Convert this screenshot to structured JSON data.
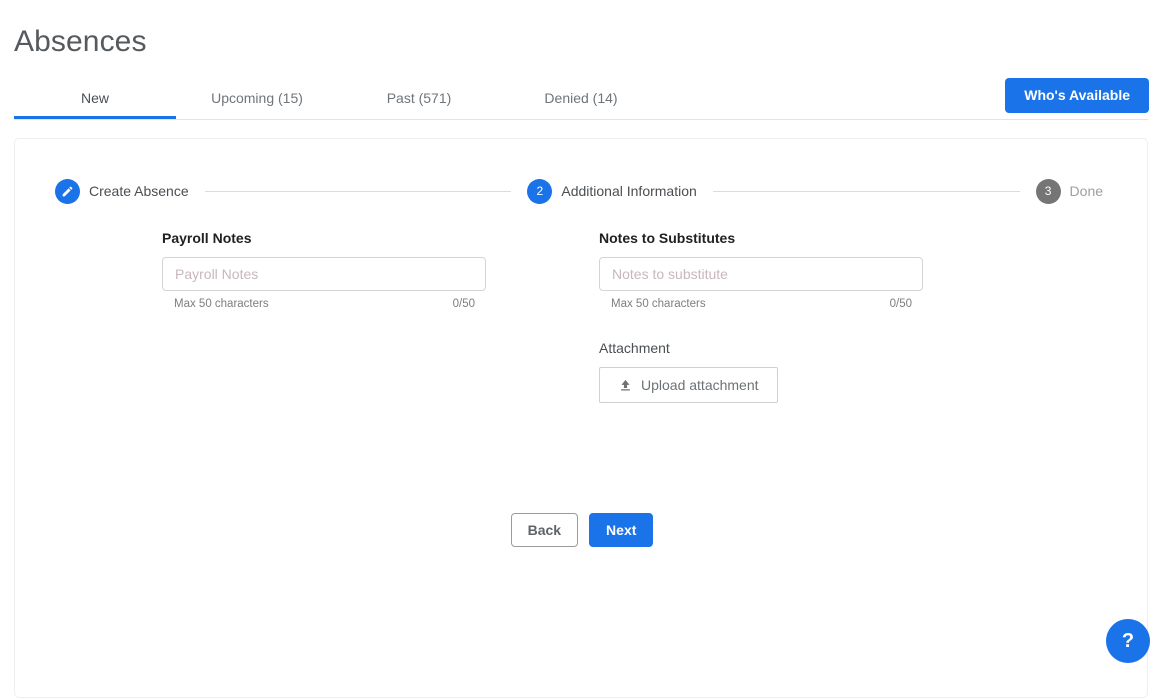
{
  "page": {
    "title": "Absences"
  },
  "tabs": [
    {
      "label": "New",
      "active": true
    },
    {
      "label": "Upcoming (15)",
      "active": false
    },
    {
      "label": "Past (571)",
      "active": false
    },
    {
      "label": "Denied (14)",
      "active": false
    }
  ],
  "header_actions": {
    "whos_available_label": "Who's Available"
  },
  "stepper": {
    "steps": [
      {
        "marker": "",
        "icon": "pencil-icon",
        "label": "Create Absence",
        "state": "completed"
      },
      {
        "marker": "2",
        "icon": "",
        "label": "Additional Information",
        "state": "current"
      },
      {
        "marker": "3",
        "icon": "",
        "label": "Done",
        "state": "pending"
      }
    ]
  },
  "form": {
    "payroll_notes": {
      "label": "Payroll Notes",
      "placeholder": "Payroll Notes",
      "value": "",
      "helper": "Max 50 characters",
      "counter": "0/50"
    },
    "notes_to_substitutes": {
      "label": "Notes to Substitutes",
      "placeholder": "Notes to substitute",
      "value": "",
      "helper": "Max 50 characters",
      "counter": "0/50"
    },
    "attachment": {
      "label": "Attachment",
      "upload_label": "Upload attachment",
      "upload_icon": "upload-icon"
    }
  },
  "actions": {
    "back_label": "Back",
    "next_label": "Next"
  },
  "help": {
    "label": "?",
    "icon": "question-mark-icon"
  },
  "colors": {
    "accent": "#1a73e8",
    "pending_step": "#757575",
    "text_primary": "#3c4043",
    "text_muted": "#9aa0a6",
    "border": "#d4d4d4"
  }
}
